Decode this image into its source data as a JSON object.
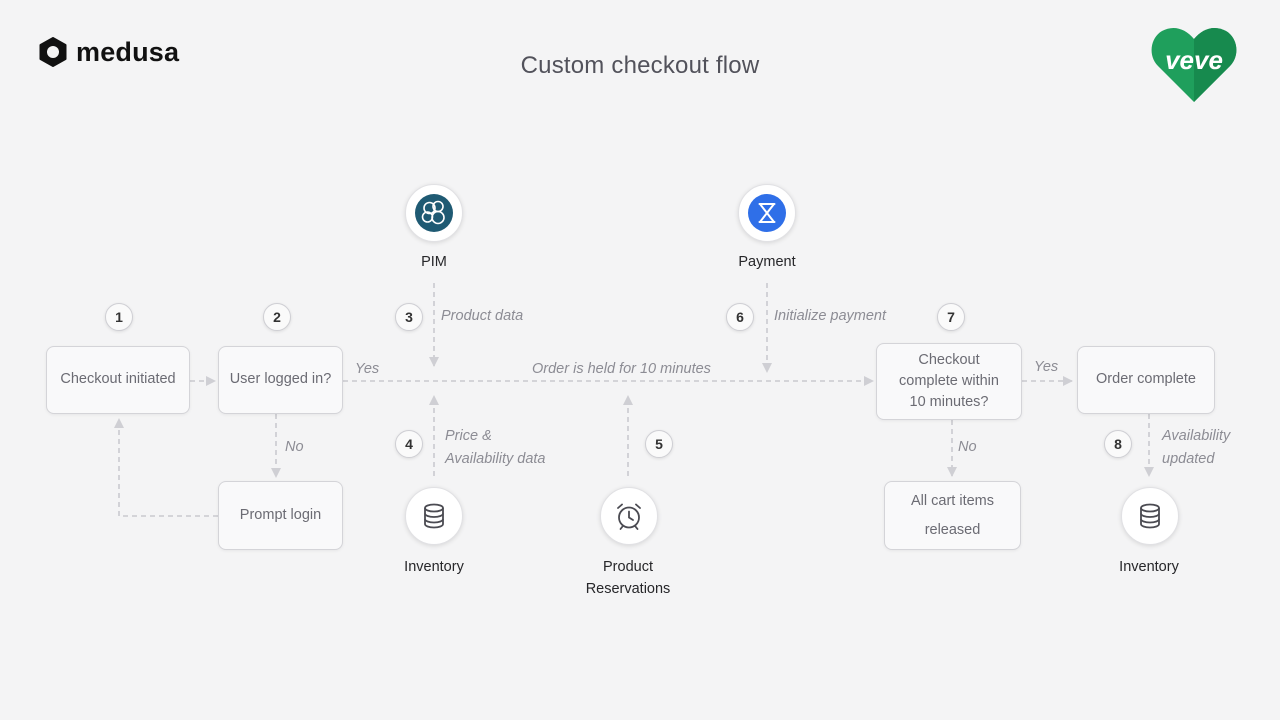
{
  "title": "Custom checkout flow",
  "brand": {
    "left": "medusa",
    "right": "veve"
  },
  "colors": {
    "edge": "#cfcfd4",
    "pim_ring": "#1f5a73",
    "payment_blue": "#2f6fe8",
    "veve_green": "#1f9f5c"
  },
  "steps": [
    "1",
    "2",
    "3",
    "4",
    "5",
    "6",
    "7",
    "8"
  ],
  "nodes": {
    "checkout_initiated": "Checkout initiated",
    "user_logged_in": "User logged in?",
    "prompt_login": "Prompt login",
    "checkout_complete": [
      "Checkout",
      "complete within",
      "10 minutes?"
    ],
    "order_complete": "Order complete",
    "cart_released": [
      "All cart items",
      "released"
    ]
  },
  "services": {
    "pim": {
      "label": "PIM",
      "icon": "pim-icon"
    },
    "payment": {
      "label": "Payment",
      "icon": "payment-icon"
    },
    "inventory_a": {
      "label": "Inventory",
      "icon": "database-icon"
    },
    "reservations": {
      "label": [
        "Product",
        "Reservations"
      ],
      "icon": "alarm-clock-icon"
    },
    "inventory_b": {
      "label": "Inventory",
      "icon": "database-icon"
    }
  },
  "edge_labels": {
    "yes_1": "Yes",
    "no_1": "No",
    "product_data": "Product data",
    "price_availability": [
      "Price &",
      "Availability data"
    ],
    "order_held": "Order is held for 10 minutes",
    "initialize_payment": "Initialize payment",
    "yes_2": "Yes",
    "no_2": "No",
    "availability_updated": [
      "Availability",
      "updated"
    ]
  }
}
